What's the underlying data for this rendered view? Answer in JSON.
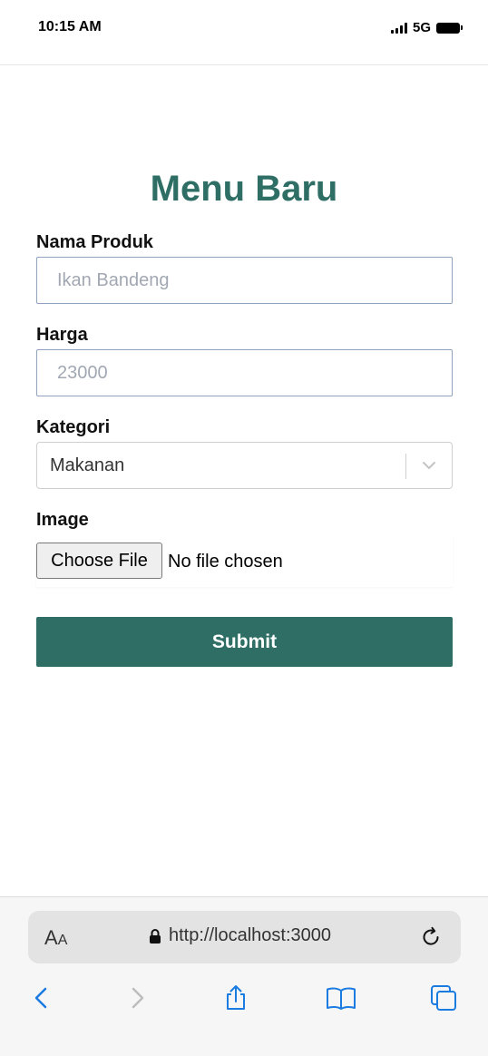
{
  "status_bar": {
    "time": "10:15 AM",
    "network": "5G"
  },
  "page": {
    "title": "Menu Baru",
    "form": {
      "nama_produk": {
        "label": "Nama Produk",
        "placeholder": "Ikan Bandeng"
      },
      "harga": {
        "label": "Harga",
        "placeholder": "23000"
      },
      "kategori": {
        "label": "Kategori",
        "selected": "Makanan"
      },
      "image": {
        "label": "Image",
        "button_label": "Choose File",
        "status": "No file chosen"
      },
      "submit_label": "Submit"
    }
  },
  "browser": {
    "text_size_label_big": "A",
    "text_size_label_small": "A",
    "url": "http://localhost:3000",
    "accent_color": "#1a73e8"
  },
  "colors": {
    "brand": "#2e6e65",
    "link_blue": "#1a7be0"
  }
}
